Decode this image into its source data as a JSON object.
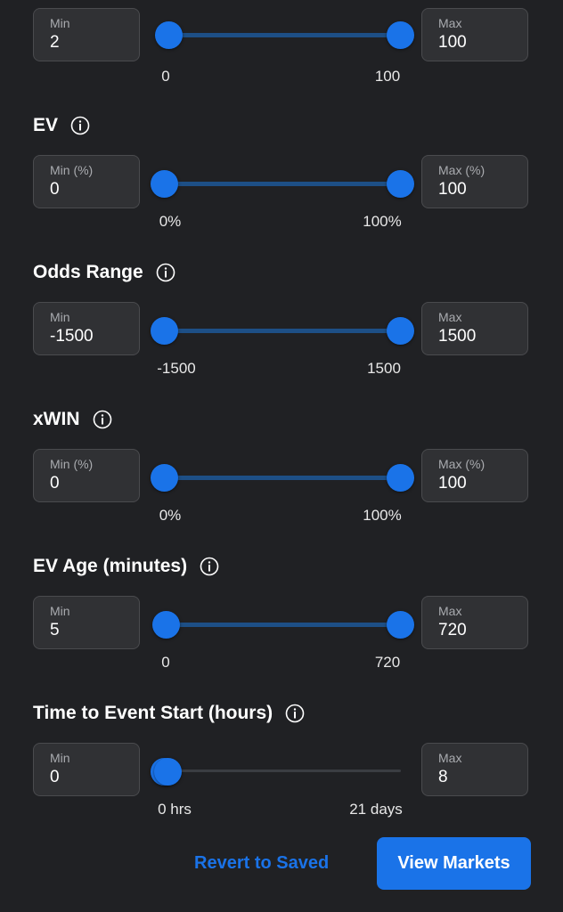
{
  "filters": [
    {
      "title": "",
      "min_label": "Min",
      "min_value": "2",
      "max_label": "Max",
      "max_value": "100",
      "range_lo": "0",
      "range_hi": "100",
      "lo_fraction": 0.02,
      "hi_fraction": 1.0
    },
    {
      "title": "EV",
      "min_label": "Min (%)",
      "min_value": "0",
      "max_label": "Max (%)",
      "max_value": "100",
      "range_lo": "0%",
      "range_hi": "100%",
      "lo_fraction": 0.0,
      "hi_fraction": 1.0
    },
    {
      "title": "Odds Range",
      "min_label": "Min",
      "min_value": "-1500",
      "max_label": "Max",
      "max_value": "1500",
      "range_lo": "-1500",
      "range_hi": "1500",
      "lo_fraction": 0.0,
      "hi_fraction": 1.0
    },
    {
      "title": "xWIN",
      "min_label": "Min (%)",
      "min_value": "0",
      "max_label": "Max (%)",
      "max_value": "100",
      "range_lo": "0%",
      "range_hi": "100%",
      "lo_fraction": 0.0,
      "hi_fraction": 1.0
    },
    {
      "title": "EV Age (minutes)",
      "min_label": "Min",
      "min_value": "5",
      "max_label": "Max",
      "max_value": "720",
      "range_lo": "0",
      "range_hi": "720",
      "lo_fraction": 0.007,
      "hi_fraction": 1.0
    },
    {
      "title": "Time to Event Start (hours)",
      "min_label": "Min",
      "min_value": "0",
      "max_label": "Max",
      "max_value": "8",
      "range_lo": "0 hrs",
      "range_hi": "21 days",
      "lo_fraction": 0.0,
      "hi_fraction": 0.016
    }
  ],
  "footer": {
    "revert_label": "Revert to Saved",
    "view_label": "View Markets"
  },
  "colors": {
    "accent": "#1a73e8",
    "track": "#1d4f86",
    "background": "#202124",
    "box": "#303134"
  },
  "icons": {
    "info": "info-icon"
  }
}
